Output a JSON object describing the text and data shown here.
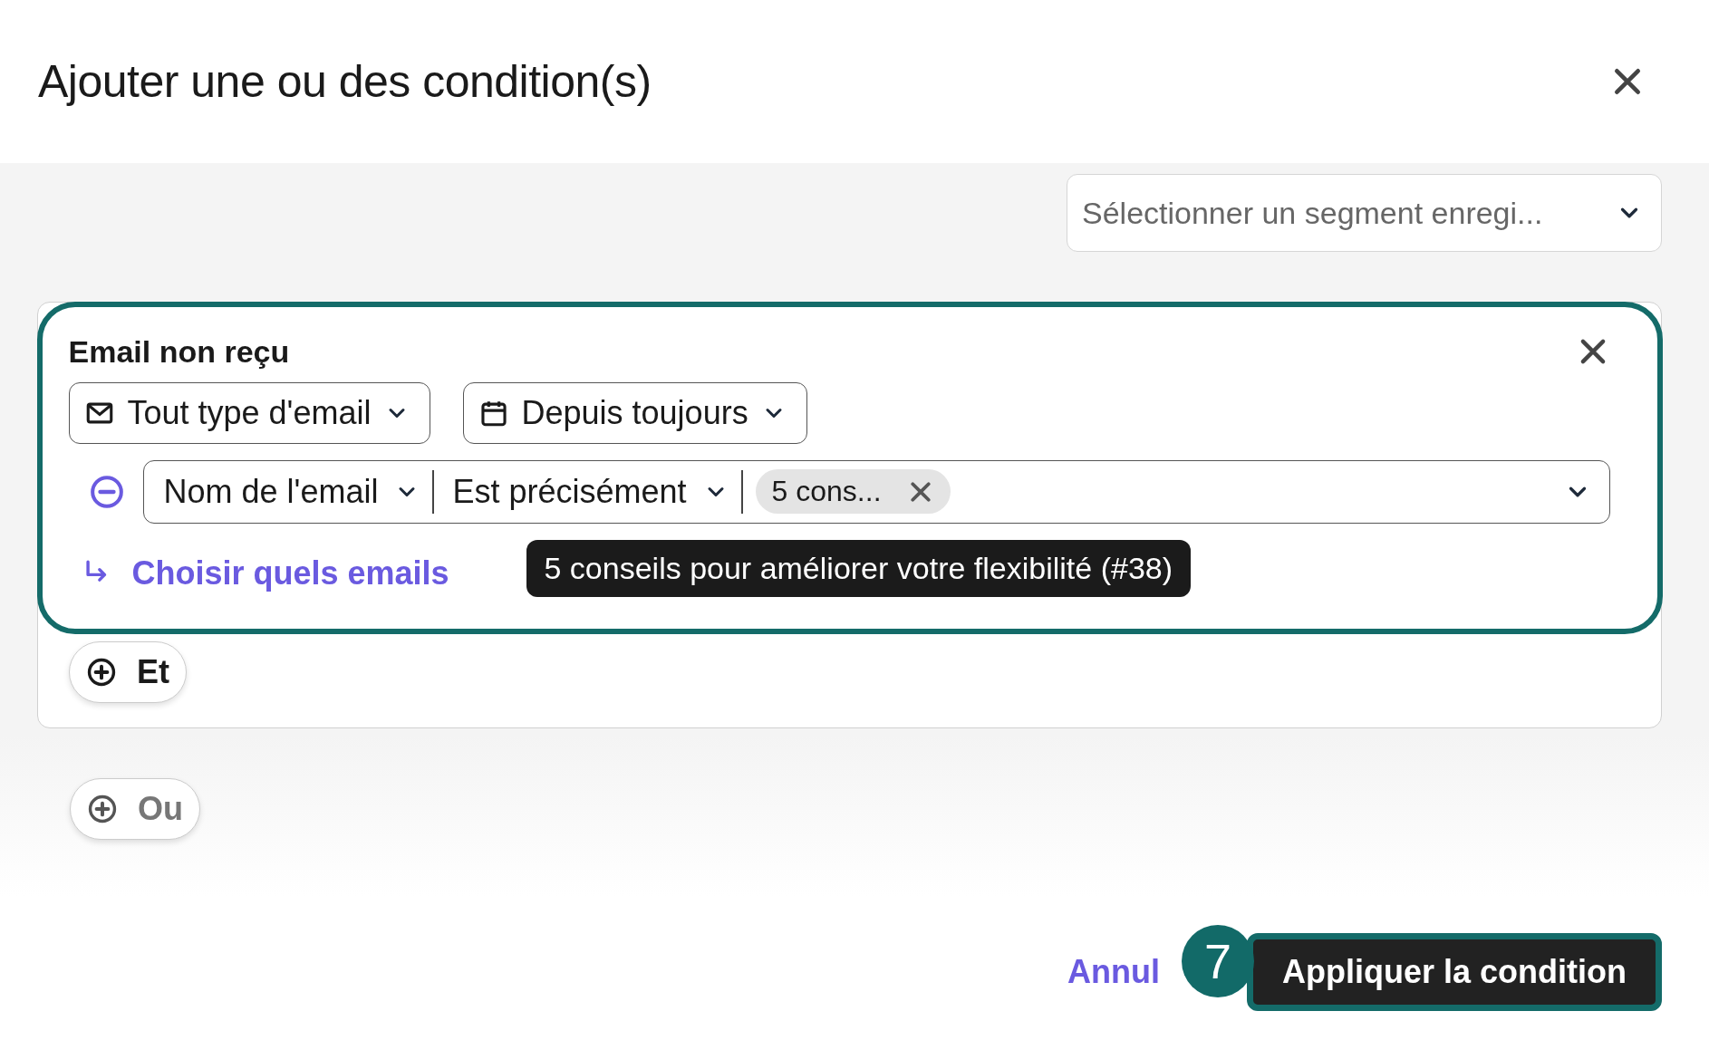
{
  "dialog": {
    "title": "Ajouter une ou des condition(s)"
  },
  "segment_select": {
    "placeholder": "Sélectionner un segment enregi..."
  },
  "condition": {
    "title": "Email non reçu",
    "filters": [
      {
        "kind": "email",
        "label": "Tout type d'email"
      },
      {
        "kind": "calendar",
        "label": "Depuis toujours"
      }
    ],
    "rule": {
      "field": "Nom de l'email",
      "operator": "Est précisément",
      "tags": [
        {
          "label": "5 cons..."
        }
      ]
    },
    "tooltip": "5 conseils pour améliorer votre flexibilité (#38)",
    "link": "Choisir quels emails"
  },
  "and_button": "Et",
  "or_button": "Ou",
  "footer": {
    "cancel": "Annul",
    "step_badge": "7",
    "apply": "Appliquer la condition"
  }
}
